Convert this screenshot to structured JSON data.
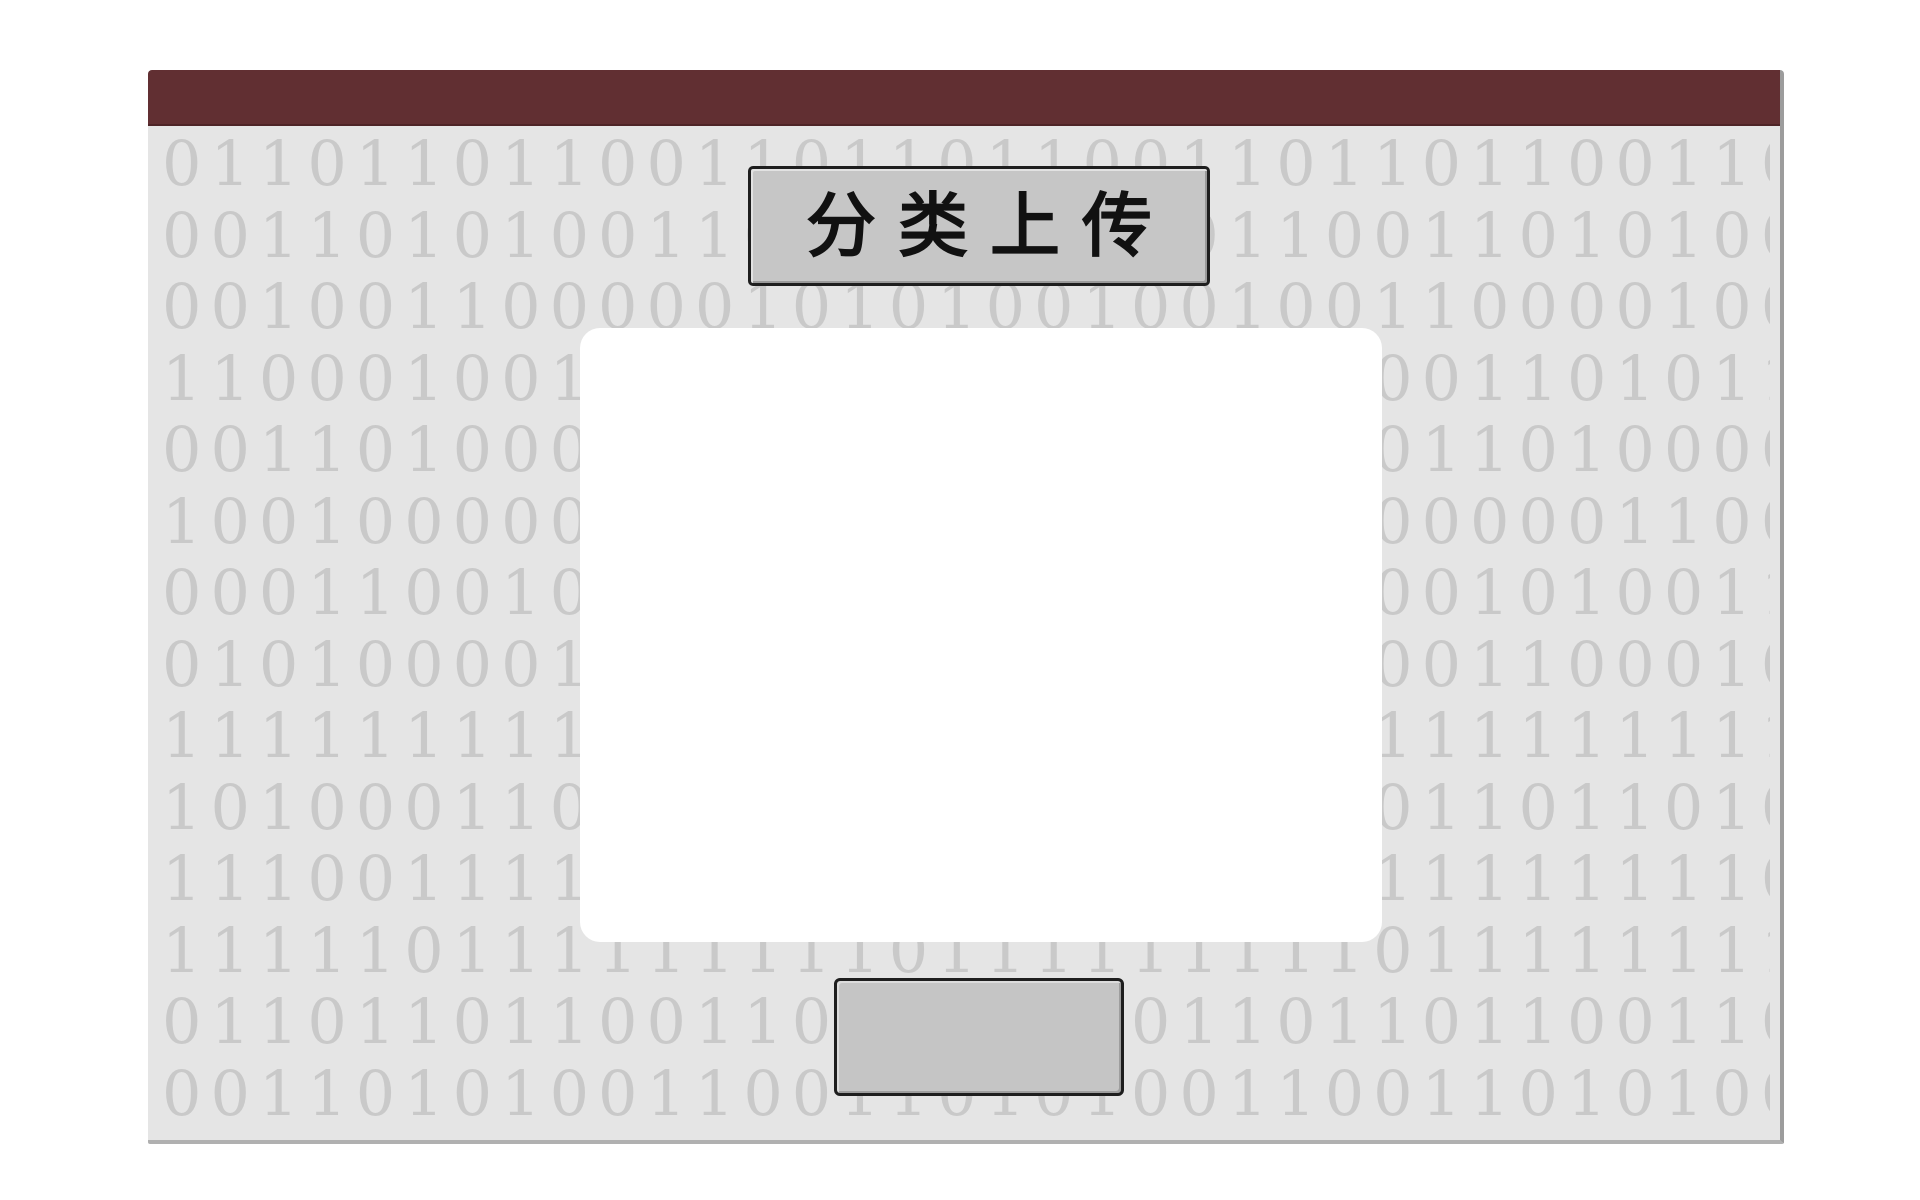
{
  "window": {
    "title": "",
    "titlebar_color": "#612f32",
    "background_color": "#e5e5e5"
  },
  "background_pattern": {
    "style": "binary digits",
    "color": "#c9c9c9",
    "rows": [
      "0110110110011011011001101101100110110110",
      "0011010100110011010100110011010100110011",
      "0010011000001010100100100110000100100110",
      "1100010011100101000101001001101011000100",
      "0011010000010100001101000011010000110100",
      "1001000000110000011010010000001100000110",
      "0001100101001100100100011001010011001001",
      "0101000011000101000010100001100010100001",
      "1111111111111111111111111111111111111111",
      "1010001101101000110110100011011010001101",
      "1110011111111001111111100111111110011111",
      "1111101111111110111111111011111111101111",
      "0110110110011011011001101101100110110110",
      "0011010100110011010100110011010100110011"
    ]
  },
  "upload_title_button": {
    "label": "分类上传",
    "color": "#c6c6c6"
  },
  "drop_area": {
    "color": "#ffffff"
  },
  "bottom_button": {
    "label": "",
    "color": "#c5c5c5"
  }
}
